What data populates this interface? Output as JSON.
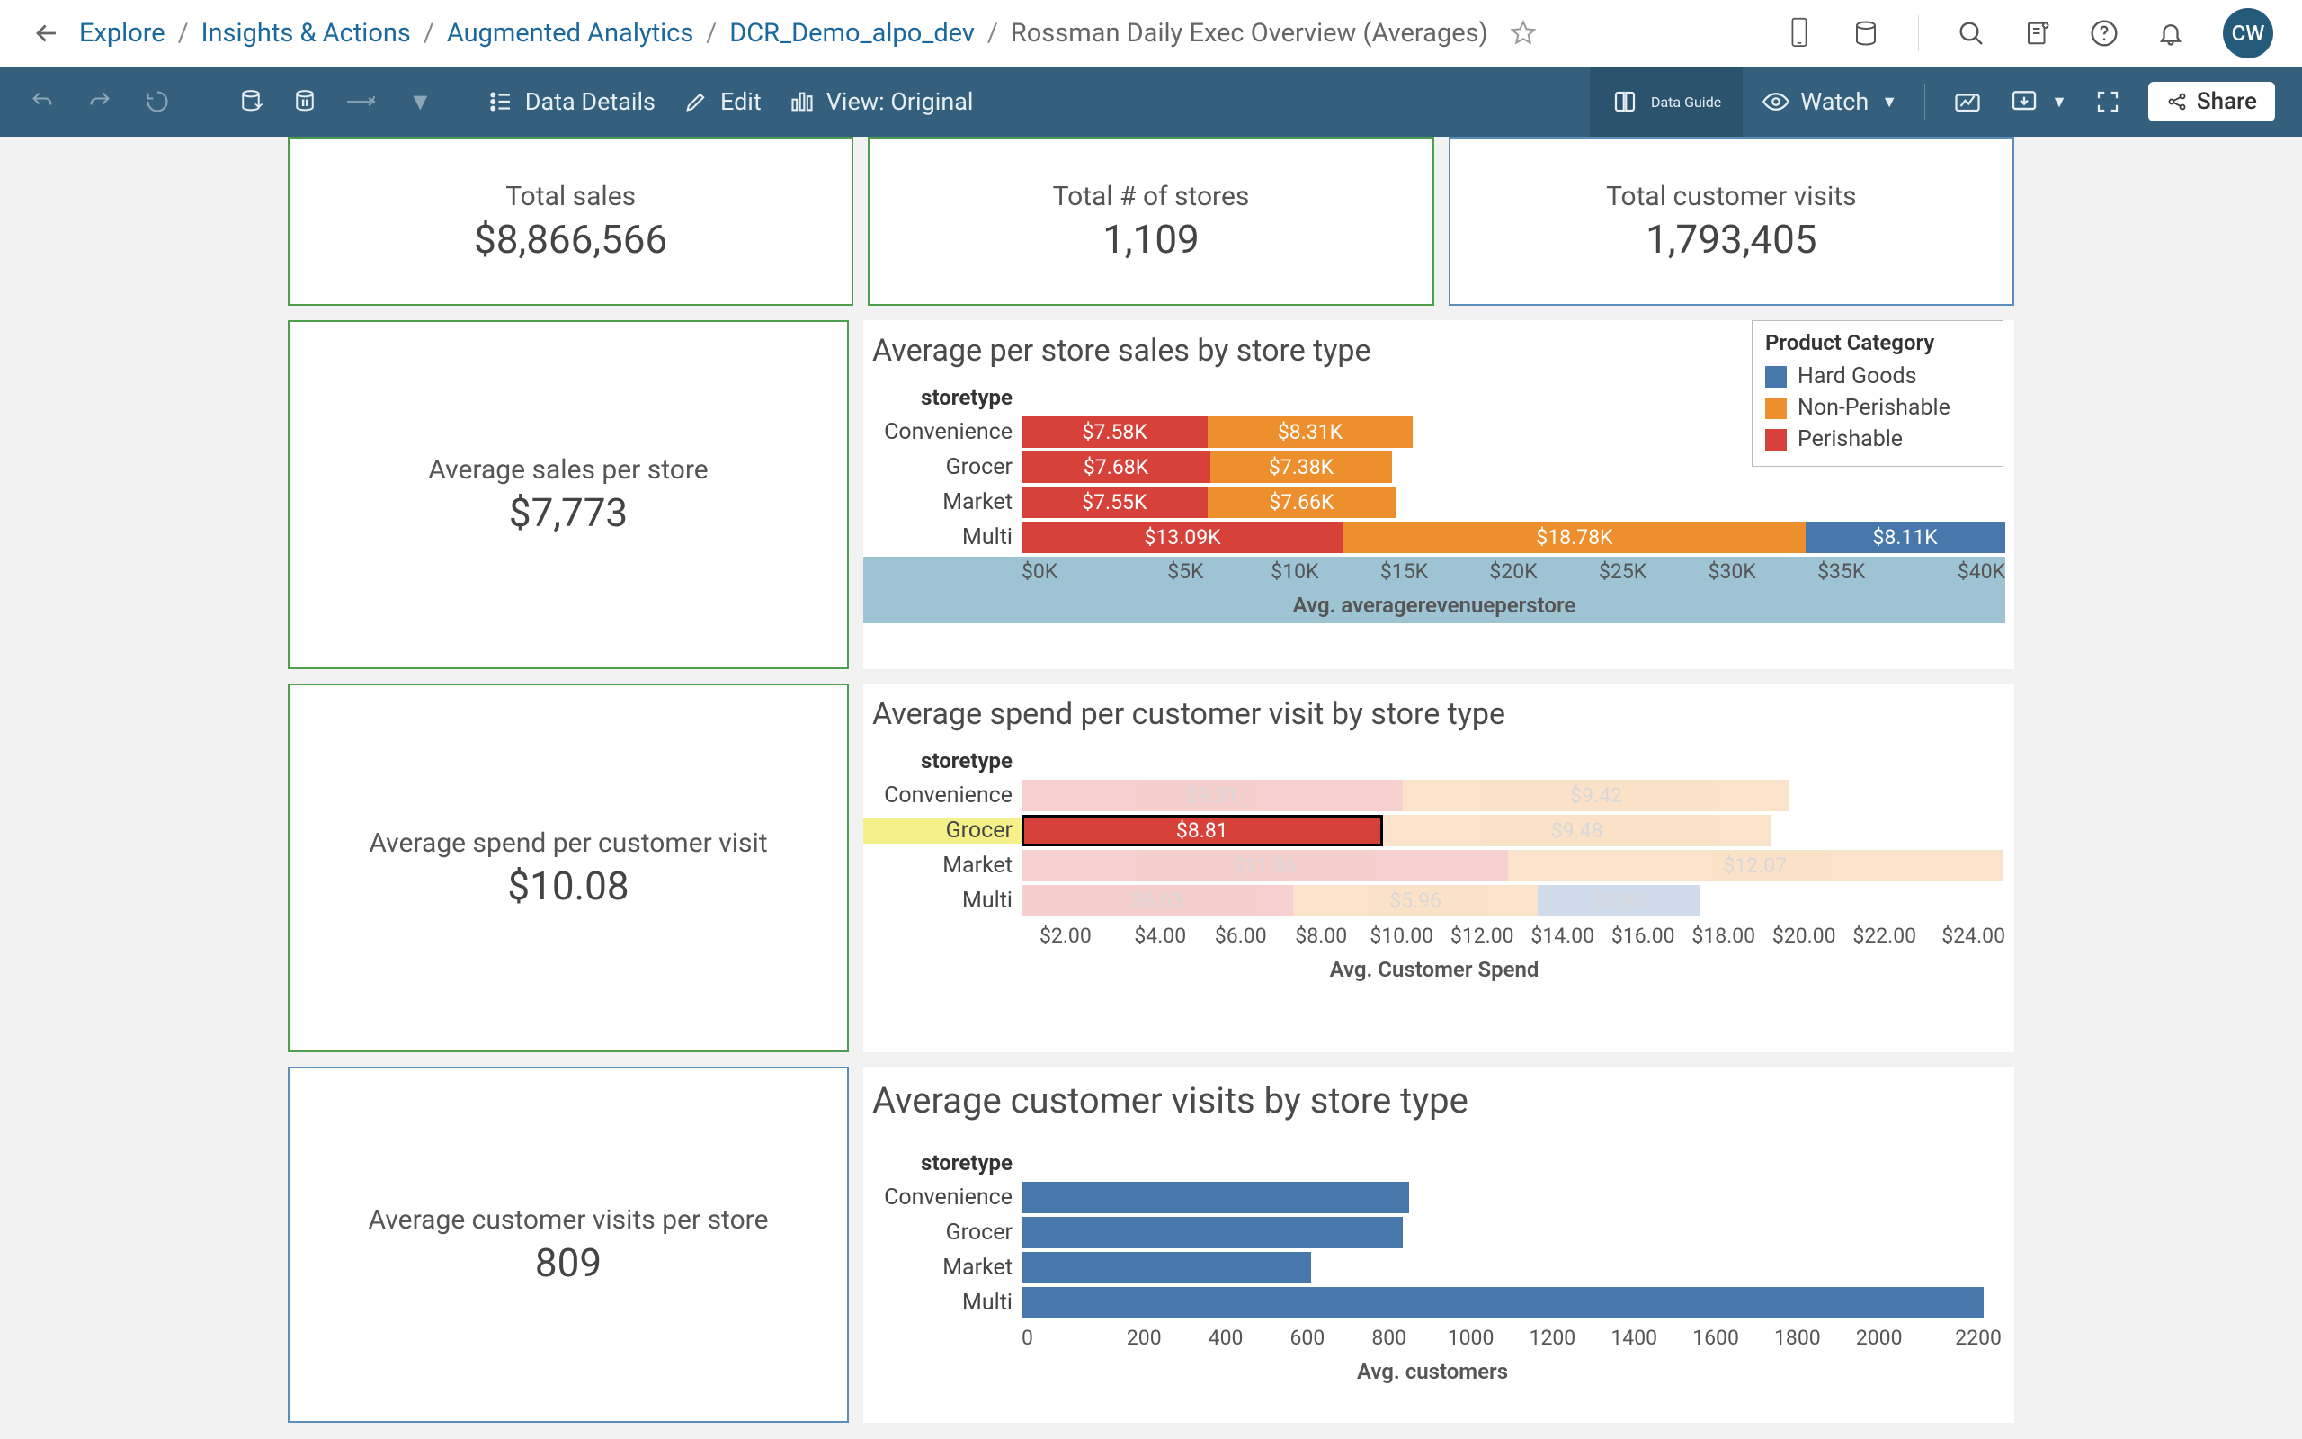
{
  "breadcrumb": {
    "items": [
      "Explore",
      "Insights & Actions",
      "Augmented Analytics",
      "DCR_Demo_alpo_dev"
    ],
    "current": "Rossman Daily Exec Overview (Averages)"
  },
  "avatar_initials": "CW",
  "toolbar": {
    "data_details": "Data Details",
    "edit": "Edit",
    "view": "View: Original",
    "data_guide": "Data Guide",
    "watch": "Watch",
    "share": "Share"
  },
  "top_cards": [
    {
      "title": "Total sales",
      "value": "$8,866,566",
      "style": "green"
    },
    {
      "title": "Total # of stores",
      "value": "1,109",
      "style": "green"
    },
    {
      "title": "Total customer visits",
      "value": "1,793,405",
      "style": "blue"
    }
  ],
  "section1": {
    "side": {
      "title": "Average sales per store",
      "value": "$7,773"
    },
    "title": "Average per store sales by store type",
    "row_header": "storetype",
    "legend_title": "Product Category",
    "legend": [
      {
        "label": "Hard Goods",
        "cls": "sw-hard"
      },
      {
        "label": "Non-Perishable",
        "cls": "sw-non"
      },
      {
        "label": "Perishable",
        "cls": "sw-per"
      }
    ],
    "axis_ticks": [
      "$0K",
      "$5K",
      "$10K",
      "$15K",
      "$20K",
      "$25K",
      "$30K",
      "$35K",
      "$40K"
    ],
    "axis_title": "Avg. averagerevenueperstore"
  },
  "section2": {
    "side": {
      "title": "Average spend per customer visit",
      "value": "$10.08"
    },
    "title": "Average spend per customer visit by store type",
    "row_header": "storetype",
    "axis_ticks": [
      "$2.00",
      "$4.00",
      "$6.00",
      "$8.00",
      "$10.00",
      "$12.00",
      "$14.00",
      "$16.00",
      "$18.00",
      "$20.00",
      "$22.00",
      "$24.00"
    ],
    "axis_title": "Avg. Customer Spend"
  },
  "section3": {
    "side": {
      "title": "Average customer visits per store",
      "value": "809"
    },
    "title": "Average customer visits by store type",
    "row_header": "storetype",
    "axis_ticks": [
      "0",
      "200",
      "400",
      "600",
      "800",
      "1000",
      "1200",
      "1400",
      "1600",
      "1800",
      "2000",
      "2200"
    ],
    "axis_title": "Avg. customers"
  },
  "chart_data": [
    {
      "type": "bar",
      "stacked": true,
      "title": "Average per store sales by store type",
      "y_category_label": "storetype",
      "categories": [
        "Convenience",
        "Grocer",
        "Market",
        "Multi"
      ],
      "series": [
        {
          "name": "Perishable",
          "values": [
            7.58,
            7.68,
            7.55,
            13.09
          ],
          "unit": "K$",
          "labels": [
            "$7.58K",
            "$7.68K",
            "$7.55K",
            "$13.09K"
          ]
        },
        {
          "name": "Non-Perishable",
          "values": [
            8.31,
            7.38,
            7.66,
            18.78
          ],
          "unit": "K$",
          "labels": [
            "$8.31K",
            "$7.38K",
            "$7.66K",
            "$18.78K"
          ]
        },
        {
          "name": "Hard Goods",
          "values": [
            null,
            null,
            null,
            8.11
          ],
          "unit": "K$",
          "labels": [
            "",
            "",
            "",
            "$8.11K"
          ]
        }
      ],
      "xlabel": "Avg. averagerevenueperstore",
      "xlim": [
        0,
        40
      ],
      "x_tick_labels": [
        "$0K",
        "$5K",
        "$10K",
        "$15K",
        "$20K",
        "$25K",
        "$30K",
        "$35K",
        "$40K"
      ],
      "legend": [
        "Hard Goods",
        "Non-Perishable",
        "Perishable"
      ]
    },
    {
      "type": "bar",
      "stacked": true,
      "title": "Average spend per customer visit by store type",
      "y_category_label": "storetype",
      "categories": [
        "Convenience",
        "Grocer",
        "Market",
        "Multi"
      ],
      "series": [
        {
          "name": "Perishable",
          "values": [
            9.31,
            8.81,
            11.86,
            6.63
          ],
          "unit": "$",
          "labels": [
            "$9.31",
            "$8.81",
            "$11.86",
            "$6.63"
          ]
        },
        {
          "name": "Non-Perishable",
          "values": [
            9.42,
            9.48,
            12.07,
            5.96
          ],
          "unit": "$",
          "labels": [
            "$9.42",
            "$9.48",
            "$12.07",
            "$5.96"
          ]
        },
        {
          "name": "Hard Goods",
          "values": [
            null,
            null,
            null,
            3.95
          ],
          "unit": "$",
          "labels": [
            "",
            "",
            "",
            "$3.95"
          ]
        }
      ],
      "highlighted": {
        "category": "Grocer",
        "series": "Perishable"
      },
      "xlabel": "Avg. Customer Spend",
      "x_tick_labels": [
        "$2.00",
        "$4.00",
        "$6.00",
        "$8.00",
        "$10.00",
        "$12.00",
        "$14.00",
        "$16.00",
        "$18.00",
        "$20.00",
        "$22.00",
        "$24.00"
      ],
      "xlim": [
        0,
        24
      ]
    },
    {
      "type": "bar",
      "title": "Average customer visits by store type",
      "y_category_label": "storetype",
      "categories": [
        "Convenience",
        "Grocer",
        "Market",
        "Multi"
      ],
      "values": [
        870,
        855,
        650,
        2160
      ],
      "xlabel": "Avg. customers",
      "xlim": [
        0,
        2200
      ],
      "x_tick_labels": [
        "0",
        "200",
        "400",
        "600",
        "800",
        "1000",
        "1200",
        "1400",
        "1600",
        "1800",
        "2000",
        "2200"
      ]
    }
  ]
}
